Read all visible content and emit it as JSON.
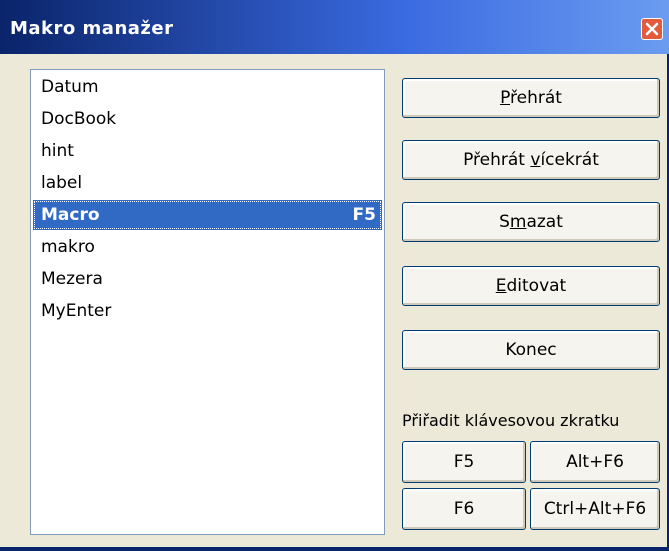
{
  "window": {
    "title": "Makro manažer",
    "accent": "#0a246a",
    "selection_color": "#316ac5"
  },
  "icons": {
    "close": "close-icon"
  },
  "macros": [
    {
      "name": "Datum",
      "shortcut": ""
    },
    {
      "name": "DocBook",
      "shortcut": ""
    },
    {
      "name": "hint",
      "shortcut": ""
    },
    {
      "name": "label",
      "shortcut": ""
    },
    {
      "name": "Macro",
      "shortcut": "F5",
      "selected": true
    },
    {
      "name": "makro",
      "shortcut": ""
    },
    {
      "name": "Mezera",
      "shortcut": ""
    },
    {
      "name": "MyEnter",
      "shortcut": ""
    }
  ],
  "buttons": {
    "play": {
      "before": "",
      "underline": "P",
      "after": "řehrát"
    },
    "play_multiple": {
      "before": "Přehrát ",
      "underline": "v",
      "after": "ícekrát"
    },
    "delete": {
      "before": "S",
      "underline": "m",
      "after": "azat"
    },
    "edit": {
      "before": "",
      "underline": "E",
      "after": "ditovat"
    },
    "close": {
      "before": "Konec",
      "underline": "",
      "after": ""
    }
  },
  "shortcut_assign": {
    "label": "Přiřadit klávesovou zkratku",
    "keys": [
      "F5",
      "Alt+F6",
      "F6",
      "Ctrl+Alt+F6"
    ]
  }
}
